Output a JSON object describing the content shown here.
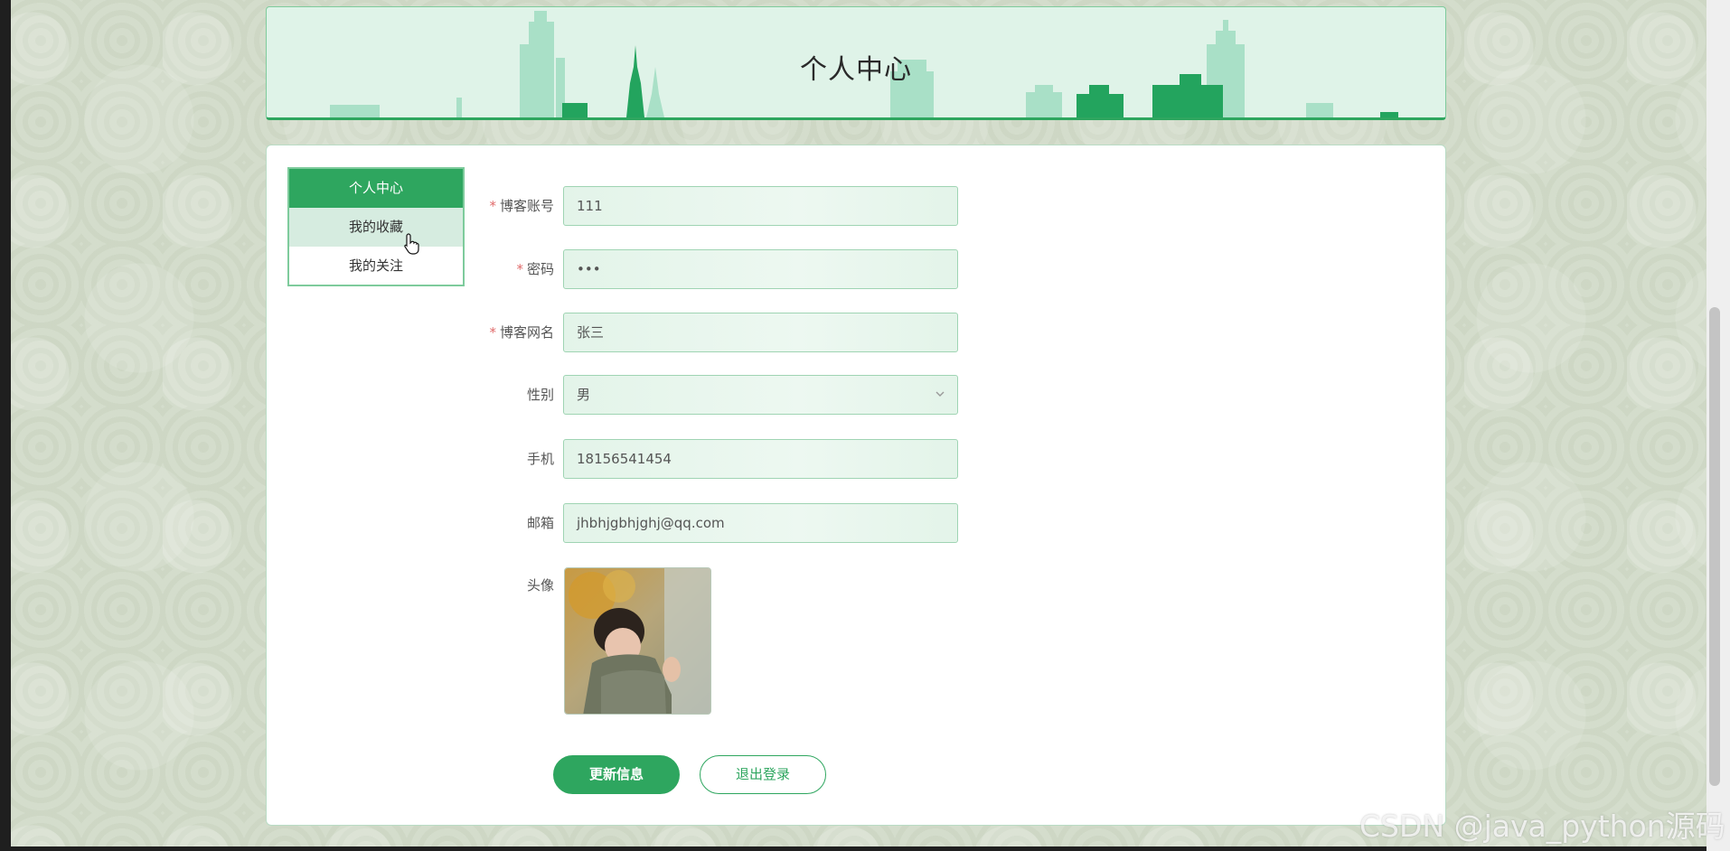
{
  "banner": {
    "title": "个人中心"
  },
  "sidebar": {
    "items": [
      {
        "label": "个人中心",
        "state": "active"
      },
      {
        "label": "我的收藏",
        "state": "hover"
      },
      {
        "label": "我的关注",
        "state": "normal"
      }
    ]
  },
  "form": {
    "account": {
      "label": "博客账号",
      "value": "111",
      "required": true
    },
    "password": {
      "label": "密码",
      "value": "•••",
      "required": true
    },
    "nickname": {
      "label": "博客网名",
      "value": "张三",
      "required": true
    },
    "gender": {
      "label": "性别",
      "value": "男",
      "required": false
    },
    "phone": {
      "label": "手机",
      "value": "18156541454",
      "required": false
    },
    "email": {
      "label": "邮箱",
      "value": "jhbhjgbhjghj@qq.com",
      "required": false
    },
    "avatar": {
      "label": "头像"
    },
    "required_mark": "*"
  },
  "buttons": {
    "update": "更新信息",
    "logout": "退出登录"
  },
  "watermark": "CSDN @java_python源码",
  "icons": {
    "cursor": "hand-pointer-icon",
    "select_arrow": "chevron-down-icon"
  },
  "colors": {
    "accent": "#2ea65f",
    "banner_bg": "#dff3e8",
    "input_bg": "#e3f4e9",
    "page_bg": "#d3dccb"
  }
}
